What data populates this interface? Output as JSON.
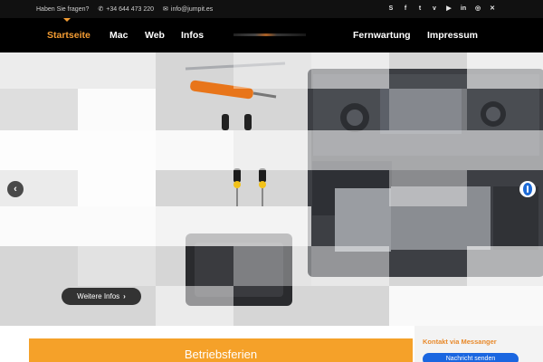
{
  "topbar": {
    "question": "Haben Sie fragen?",
    "phone": "+34 644 473 220",
    "email": "info@jumpit.es",
    "social_icons": [
      "skype-icon",
      "facebook-icon",
      "twitter-icon",
      "vimeo-icon",
      "youtube-icon",
      "linkedin-icon",
      "instagram-icon",
      "close-icon"
    ],
    "social_glyphs": [
      "S",
      "f",
      "t",
      "v",
      "▶",
      "in",
      "◎",
      "✕"
    ]
  },
  "nav": {
    "items": [
      "Startseite",
      "Mac",
      "Web",
      "Infos",
      "Fernwartung",
      "Impressum"
    ],
    "active": "Startseite",
    "active_color": "#f39c33"
  },
  "hero": {
    "prev_icon": "‹",
    "button_label": "Weitere Infos",
    "button_chevron": "›"
  },
  "banner": {
    "title": "Betriebsferien",
    "color": "#f5a129"
  },
  "messenger": {
    "label": "Kontakt via Messanger",
    "button_label": "Nachricht senden",
    "button_color": "#1a66e0"
  }
}
